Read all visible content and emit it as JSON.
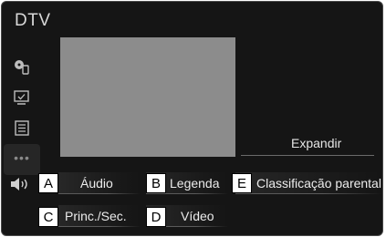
{
  "header": {
    "title": "DTV"
  },
  "sidebar": {
    "items": [
      {
        "icon": "source-disc-icon"
      },
      {
        "icon": "screen-icon"
      },
      {
        "icon": "list-icon"
      },
      {
        "icon": "more-icon",
        "label": "•••"
      }
    ]
  },
  "main": {
    "expand_label": "Expandir"
  },
  "volume": {
    "icon": "volume-icon"
  },
  "options": {
    "audio": "Áudio",
    "legenda": "Legenda",
    "classificacao": "Classificação parental",
    "princ_sec": "Princ./Sec.",
    "video": "Vídeo"
  },
  "callouts": {
    "a": "A",
    "b": "B",
    "c": "C",
    "d": "D",
    "e": "E"
  }
}
